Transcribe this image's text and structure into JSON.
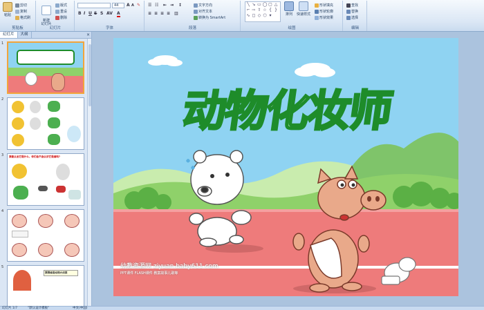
{
  "ribbon": {
    "clipboard": {
      "label": "剪贴板",
      "paste": "粘贴",
      "cut": "剪切",
      "copy": "复制",
      "format_painter": "格式刷"
    },
    "slides": {
      "label": "幻灯片",
      "new_slide": "新建\n幻灯片",
      "layout": "版式",
      "reset": "重设",
      "delete": "删除"
    },
    "font": {
      "label": "字体",
      "size": "44"
    },
    "paragraph": {
      "label": "段落",
      "text_direction": "文字方向",
      "align_text": "对齐文本",
      "convert_smartart": "转换为 SmartArt"
    },
    "drawing": {
      "label": "绘图",
      "arrange": "排列",
      "quick_styles": "快速样式",
      "shape_fill": "形状填充",
      "shape_outline": "形状轮廓",
      "shape_effects": "形状效果"
    },
    "editing": {
      "label": "编辑",
      "find": "查找",
      "replace": "替换",
      "select": "选择"
    }
  },
  "pane": {
    "tabs": [
      "幻灯片",
      "大纲"
    ],
    "close": "×",
    "slides": [
      {
        "num": "1"
      },
      {
        "num": "2"
      },
      {
        "num": "3",
        "caption": "我能认出它是什么，你们会不会认识它是谁吗?"
      },
      {
        "num": "4"
      },
      {
        "num": "5",
        "caption": "猜猜谁是动物大侦探"
      }
    ]
  },
  "slide": {
    "title": "动物化妆师",
    "watermark": "幼教资源网 ziyuan.baby611.com",
    "watermark_sub": "PPT课件 FLASH课件 教案故事儿歌等"
  },
  "status": {
    "slide_info": "幻灯片 1/7",
    "theme": "\"默认设计模板\"",
    "language": "中文(中国)"
  },
  "colors": {
    "sky": "#8fd3f2",
    "grass": "#8fd16a",
    "track": "#ee7b7b",
    "title_stroke": "#1e8c2a",
    "pig": "#e9a98a"
  }
}
